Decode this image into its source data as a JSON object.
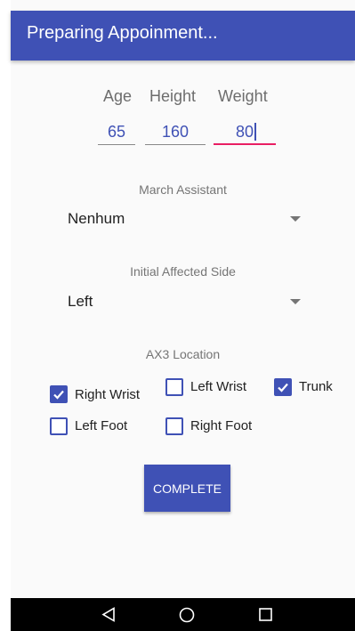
{
  "app_bar": {
    "title": "Preparing Appoinment..."
  },
  "vitals": {
    "age_label": "Age",
    "height_label": "Height",
    "weight_label": "Weight",
    "age_value": "65",
    "height_value": "160",
    "weight_value": "80"
  },
  "march_assistant": {
    "label": "March Assistant",
    "selected": "Nenhum"
  },
  "affected_side": {
    "label": "Initial Affected Side",
    "selected": "Left"
  },
  "ax3_location": {
    "label": "AX3 Location",
    "options": [
      {
        "label": "Right Wrist",
        "checked": true
      },
      {
        "label": "Left Wrist",
        "checked": false
      },
      {
        "label": "Trunk",
        "checked": true
      },
      {
        "label": "Left Foot",
        "checked": false
      },
      {
        "label": "Right Foot",
        "checked": false
      }
    ]
  },
  "actions": {
    "complete_label": "COMPLETE"
  },
  "colors": {
    "primary": "#3f51b5",
    "accent": "#e91e63"
  },
  "nav_icons": [
    "back-icon",
    "home-icon",
    "recents-icon"
  ]
}
